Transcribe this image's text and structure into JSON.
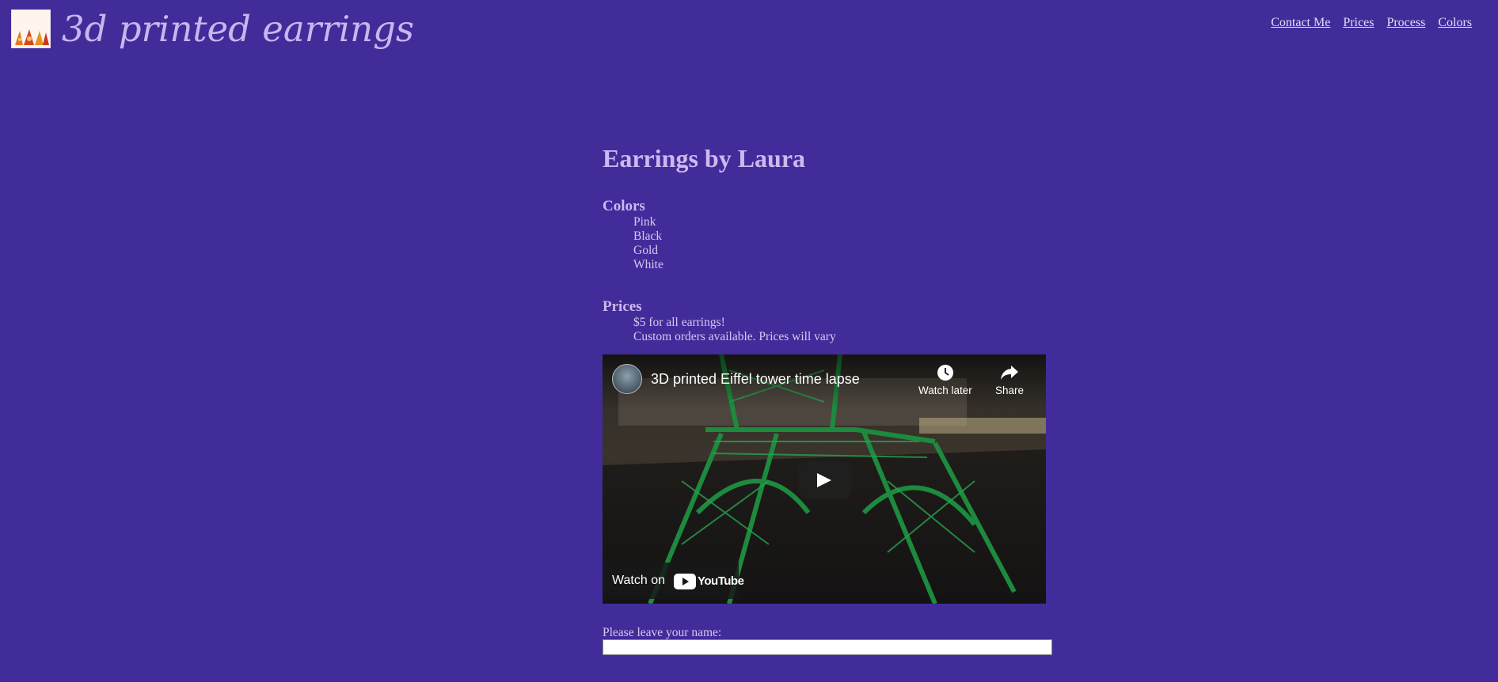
{
  "header": {
    "logo_alt": "earrings-photo",
    "site_title": "3d printed earrings",
    "nav": [
      "Contact Me",
      "Prices",
      "Process",
      "Colors"
    ]
  },
  "main": {
    "heading": "Earrings by Laura",
    "colors": {
      "heading": "Colors",
      "items": [
        "Pink",
        "Black",
        "Gold",
        "White"
      ]
    },
    "prices": {
      "heading": "Prices",
      "items": [
        "$5 for all earrings!",
        "Custom orders available. Prices will vary"
      ]
    },
    "video": {
      "title": "3D printed Eiffel tower time lapse",
      "watch_later": "Watch later",
      "share": "Share",
      "watch_on": "Watch on",
      "brand": "YouTube"
    },
    "form": {
      "name_label": "Please leave your name:",
      "name_value": ""
    }
  },
  "colors": {
    "background": "#422c9a",
    "title": "#c9b6ee",
    "text": "#d7c8f0",
    "tower_green": "#1d8a3e"
  }
}
